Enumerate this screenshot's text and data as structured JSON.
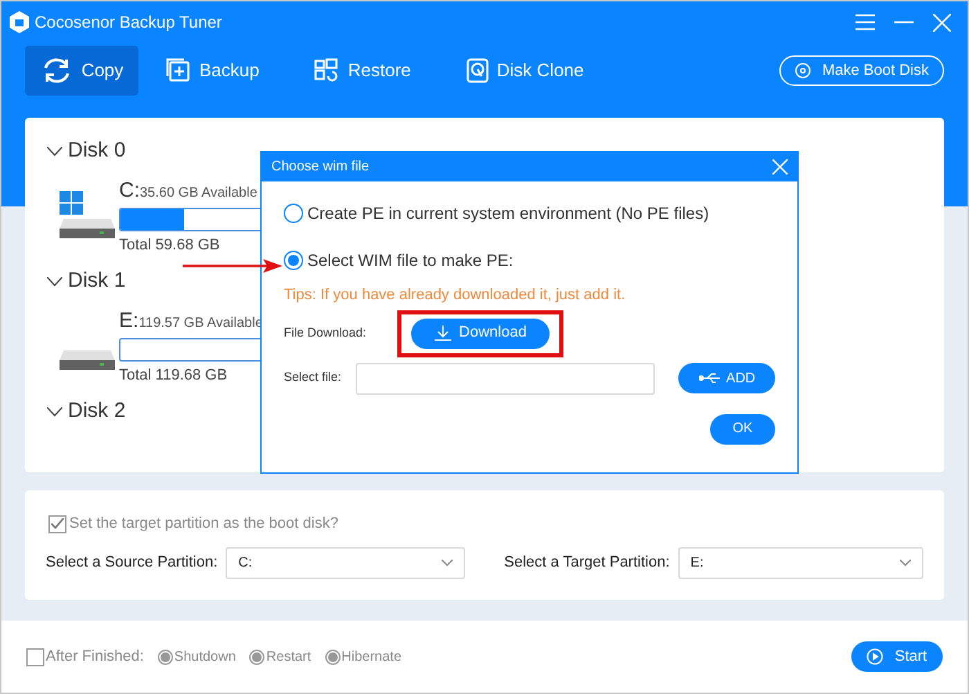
{
  "window": {
    "title": "Cocosenor Backup Tuner"
  },
  "nav": [
    {
      "label": "Copy",
      "selected": true
    },
    {
      "label": "Backup",
      "selected": false
    },
    {
      "label": "Restore",
      "selected": false
    },
    {
      "label": "Disk Clone",
      "selected": false
    }
  ],
  "make_boot_disk": "Make Boot Disk",
  "disks": [
    {
      "name": "Disk 0",
      "expanded": true,
      "partitions": [
        {
          "letter": "C:",
          "available": "35.60 GB Available",
          "total": "Total 59.68 GB",
          "system": true,
          "level": 0.23
        }
      ]
    },
    {
      "name": "Disk 1",
      "expanded": true,
      "partitions": [
        {
          "letter": "E:",
          "available": "119.57 GB Available",
          "total": "Total 119.68 GB",
          "system": false
        }
      ]
    },
    {
      "name": "Disk 2",
      "expanded": true
    }
  ],
  "dialog": {
    "title": "Choose wim file",
    "options": [
      {
        "label": "Create PE in current system environment (No PE files)",
        "selected": false
      },
      {
        "label": "Select WIM file to make PE:",
        "selected": true
      }
    ],
    "tips": "Tips: If you have already downloaded it, just add it.",
    "file_download_label": "File Download:",
    "download": "Download",
    "select_file_label": "Select file:",
    "add": "ADD",
    "ok": "OK"
  },
  "options": {
    "boot_disk": {
      "label": "Set the target partition as the boot disk?",
      "checked": true,
      "disabled": true
    },
    "source_label": "Select a Source Partition:",
    "source_value": "C:",
    "target_label": "Select a Target Partition:",
    "target_value": "E:"
  },
  "footer": {
    "after_finished": {
      "label": "After Finished:",
      "checked": false
    },
    "choices": [
      {
        "label": "Shutdown",
        "disabled": true
      },
      {
        "label": "Restart",
        "disabled": true
      },
      {
        "label": "Hibernate",
        "disabled": true
      }
    ],
    "start": "Start"
  }
}
